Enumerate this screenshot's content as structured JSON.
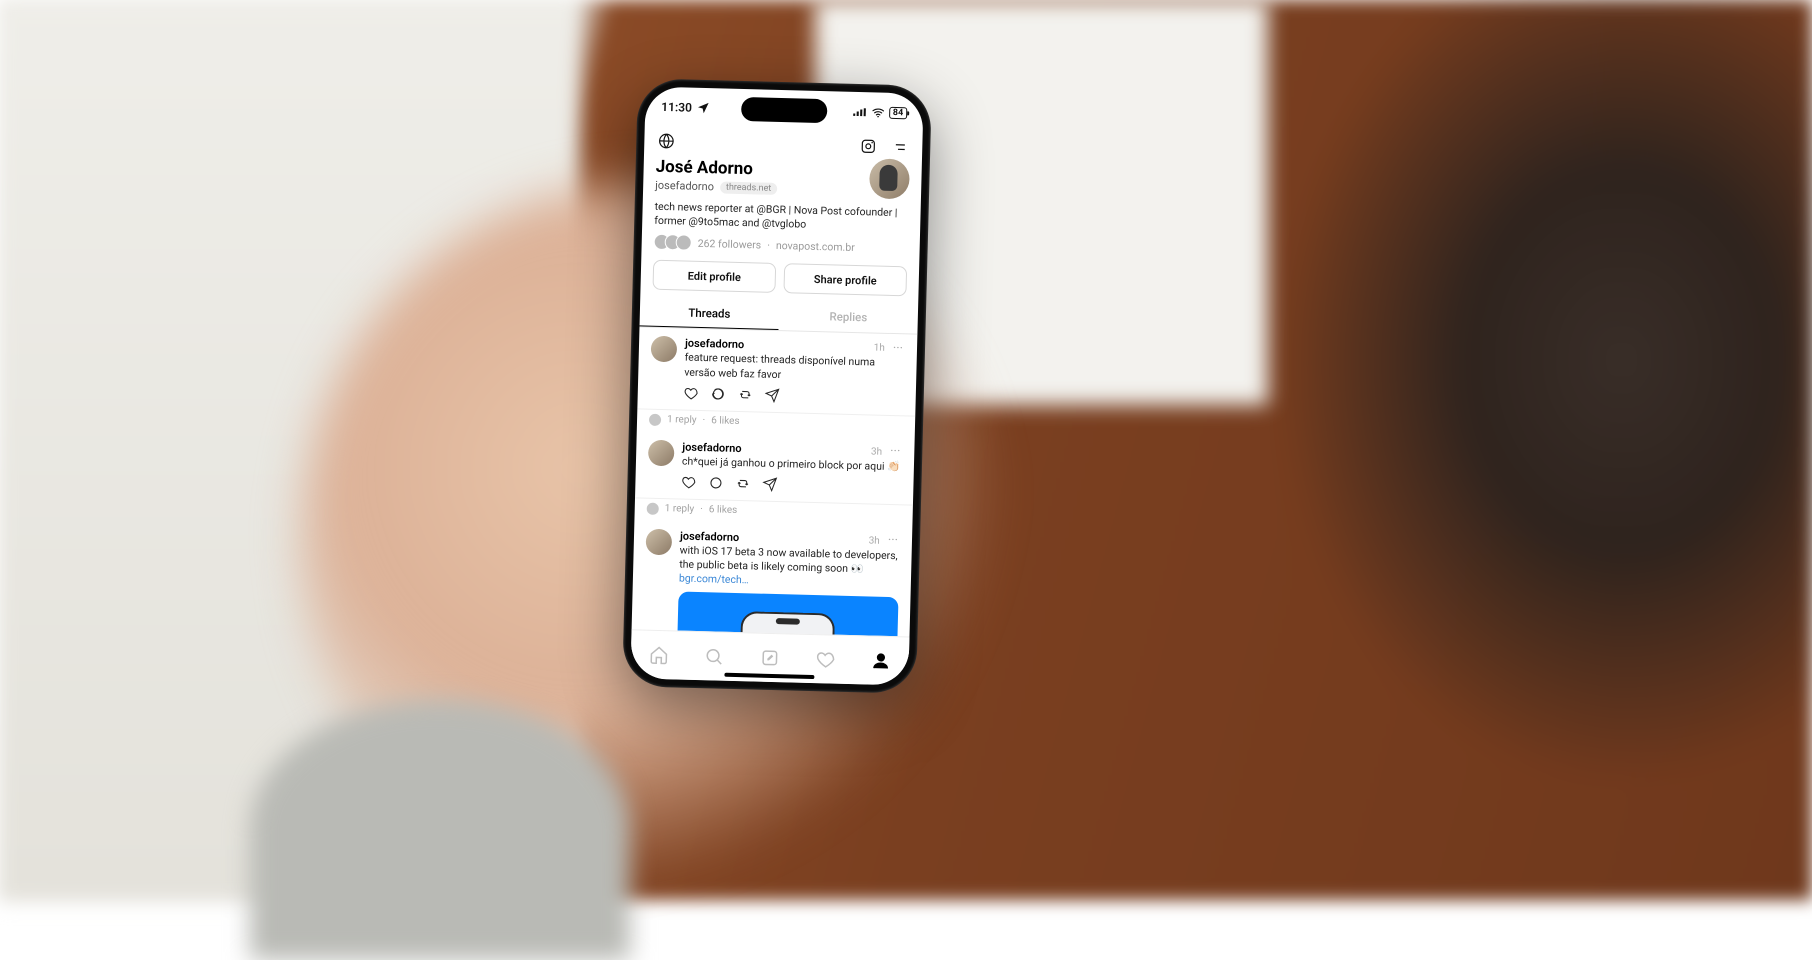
{
  "status_bar": {
    "time": "11:30",
    "battery": "84"
  },
  "profile": {
    "display_name": "José Adorno",
    "handle": "josefadorno",
    "domain_badge": "threads.net",
    "bio": "tech news reporter at @BGR | Nova Post cofounder | former @9to5mac and @tvglobo",
    "followers_text": "262 followers",
    "link_text": "novapost.com.br"
  },
  "buttons": {
    "edit_profile": "Edit profile",
    "share_profile": "Share profile"
  },
  "tabs": {
    "threads": "Threads",
    "replies": "Replies"
  },
  "posts": [
    {
      "user": "josefadorno",
      "time": "1h",
      "text": "feature request: threads disponível numa versão web faz favor",
      "replies": "1 reply",
      "likes": "6 likes"
    },
    {
      "user": "josefadorno",
      "time": "3h",
      "text": "ch*quei já ganhou o primeiro block por aqui 👏🏻",
      "replies": "1 reply",
      "likes": "6 likes"
    },
    {
      "user": "josefadorno",
      "time": "3h",
      "text": "with iOS 17 beta 3 now available to developers, the public beta is likely coming soon 👀 ",
      "link_text": "bgr.com/tech…"
    }
  ]
}
